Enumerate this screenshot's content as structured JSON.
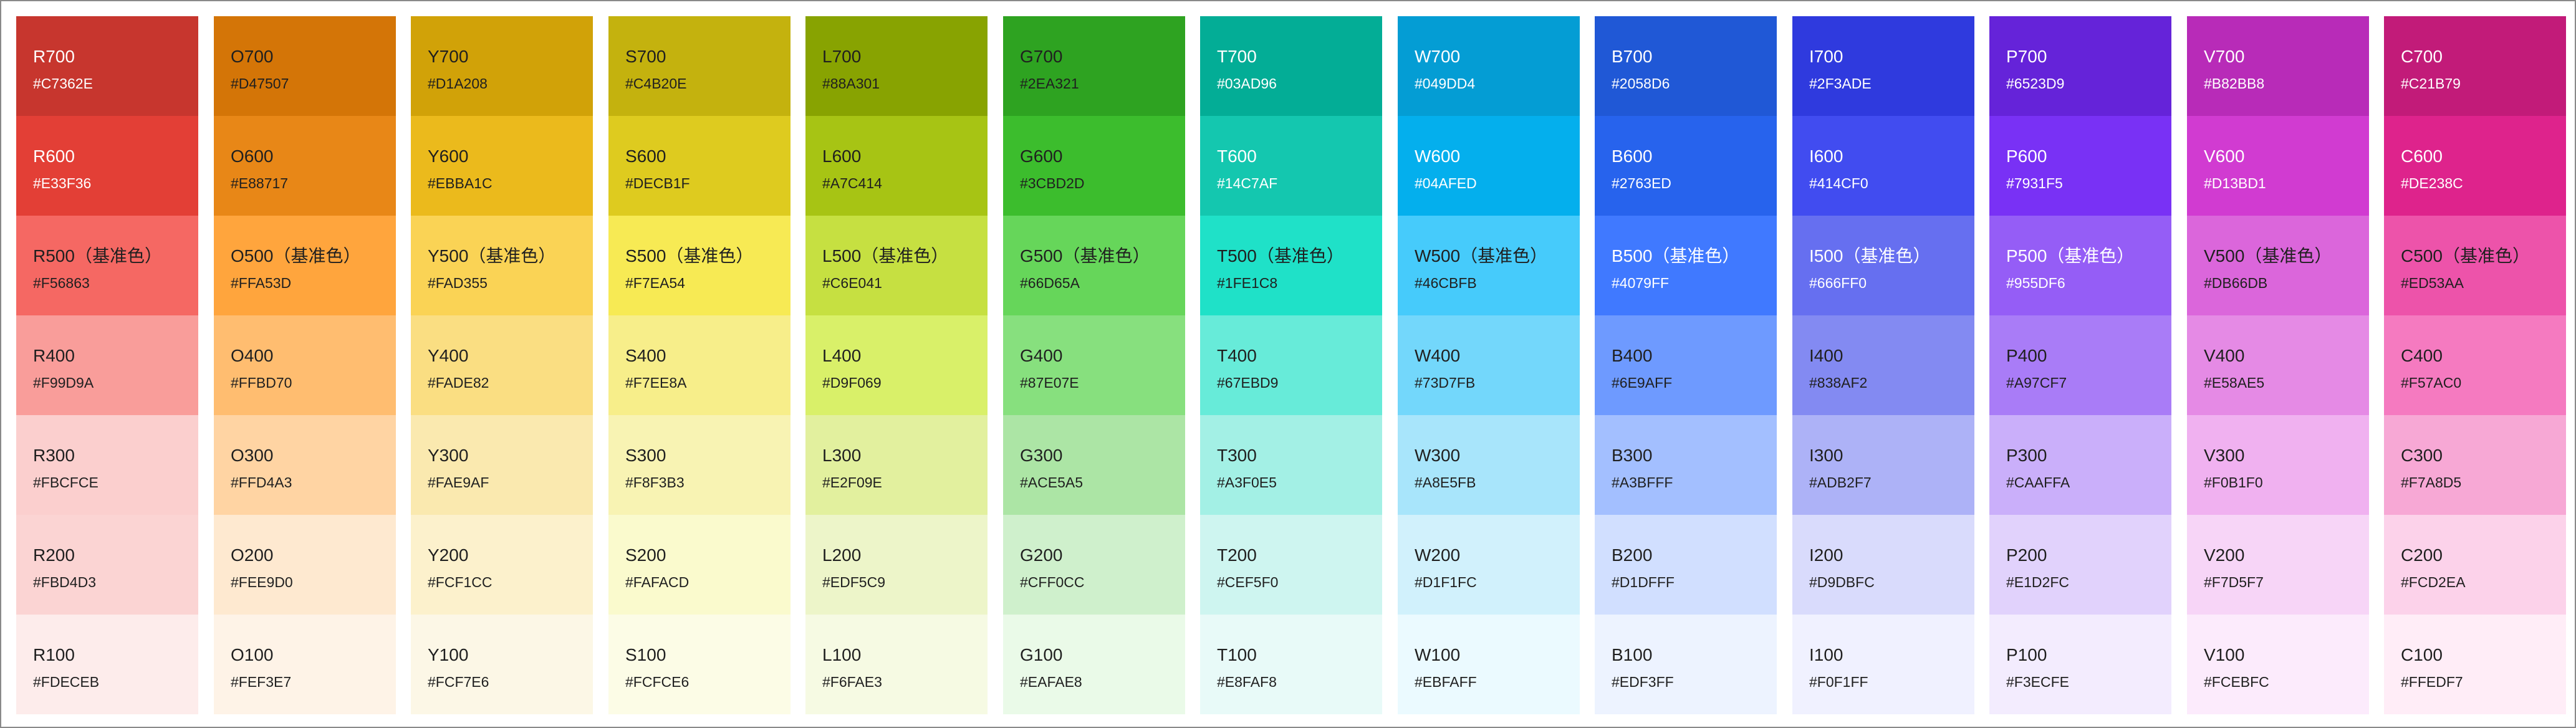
{
  "palette": [
    {
      "family": "red",
      "swatches": [
        {
          "name": "R700",
          "hex": "#C7362E",
          "color": "#C7362E",
          "text": "light"
        },
        {
          "name": "R600",
          "hex": "#E33F36",
          "color": "#E33F36",
          "text": "light"
        },
        {
          "name": "R500（基准色）",
          "hex": "#F56863",
          "color": "#F56863",
          "text": "dark"
        },
        {
          "name": "R400",
          "hex": "#F99D9A",
          "color": "#F99D9A",
          "text": "dark"
        },
        {
          "name": "R300",
          "hex": "#FBCFCE",
          "color": "#FBCFCE",
          "text": "dark"
        },
        {
          "name": "R200",
          "hex": "#FBD4D3",
          "color": "#FBD4D3",
          "text": "dark"
        },
        {
          "name": "R100",
          "hex": "#FDECEB",
          "color": "#FDECEB",
          "text": "dark"
        }
      ]
    },
    {
      "family": "orange",
      "swatches": [
        {
          "name": "O700",
          "hex": "#D47507",
          "color": "#D47507",
          "text": "dark"
        },
        {
          "name": "O600",
          "hex": "#E88717",
          "color": "#E88717",
          "text": "dark"
        },
        {
          "name": "O500（基准色）",
          "hex": "#FFA53D",
          "color": "#FFA53D",
          "text": "dark"
        },
        {
          "name": "O400",
          "hex": "#FFBD70",
          "color": "#FFBD70",
          "text": "dark"
        },
        {
          "name": "O300",
          "hex": "#FFD4A3",
          "color": "#FFD4A3",
          "text": "dark"
        },
        {
          "name": "O200",
          "hex": "#FEE9D0",
          "color": "#FEE9D0",
          "text": "dark"
        },
        {
          "name": "O100",
          "hex": "#FEF3E7",
          "color": "#FEF3E7",
          "text": "dark"
        }
      ]
    },
    {
      "family": "yellow",
      "swatches": [
        {
          "name": "Y700",
          "hex": "#D1A208",
          "color": "#D1A208",
          "text": "dark"
        },
        {
          "name": "Y600",
          "hex": "#EBBA1C",
          "color": "#EBBA1C",
          "text": "dark"
        },
        {
          "name": "Y500（基准色）",
          "hex": "#FAD355",
          "color": "#FAD355",
          "text": "dark"
        },
        {
          "name": "Y400",
          "hex": "#FADE82",
          "color": "#FADE82",
          "text": "dark"
        },
        {
          "name": "Y300",
          "hex": "#FAE9AF",
          "color": "#FAE9AF",
          "text": "dark"
        },
        {
          "name": "Y200",
          "hex": "#FCF1CC",
          "color": "#FCF1CC",
          "text": "dark"
        },
        {
          "name": "Y100",
          "hex": "#FCF7E6",
          "color": "#FCF7E6",
          "text": "dark"
        }
      ]
    },
    {
      "family": "s",
      "swatches": [
        {
          "name": "S700",
          "hex": "#C4B20E",
          "color": "#C4B20E",
          "text": "dark"
        },
        {
          "name": "S600",
          "hex": "#DECB1F",
          "color": "#DECB1F",
          "text": "dark"
        },
        {
          "name": "S500（基准色）",
          "hex": "#F7EA54",
          "color": "#F7EA54",
          "text": "dark"
        },
        {
          "name": "S400",
          "hex": "#F7EE8A",
          "color": "#F7EE8A",
          "text": "dark"
        },
        {
          "name": "S300",
          "hex": "#F8F3B3",
          "color": "#F8F3B3",
          "text": "dark"
        },
        {
          "name": "S200",
          "hex": "#FAFACD",
          "color": "#FAFACD",
          "text": "dark"
        },
        {
          "name": "S100",
          "hex": "#FCFCE6",
          "color": "#FCFCE6",
          "text": "dark"
        }
      ]
    },
    {
      "family": "lime",
      "swatches": [
        {
          "name": "L700",
          "hex": "#88A301",
          "color": "#88A301",
          "text": "dark"
        },
        {
          "name": "L600",
          "hex": "#A7C414",
          "color": "#A7C414",
          "text": "dark"
        },
        {
          "name": "L500（基准色）",
          "hex": "#C6E041",
          "color": "#C6E041",
          "text": "dark"
        },
        {
          "name": "L400",
          "hex": "#D9F069",
          "color": "#D9F069",
          "text": "dark"
        },
        {
          "name": "L300",
          "hex": "#E2F09E",
          "color": "#E2F09E",
          "text": "dark"
        },
        {
          "name": "L200",
          "hex": "#EDF5C9",
          "color": "#EDF5C9",
          "text": "dark"
        },
        {
          "name": "L100",
          "hex": "#F6FAE3",
          "color": "#F6FAE3",
          "text": "dark"
        }
      ]
    },
    {
      "family": "green",
      "swatches": [
        {
          "name": "G700",
          "hex": "#2EA321",
          "color": "#2EA321",
          "text": "dark"
        },
        {
          "name": "G600",
          "hex": "#3CBD2D",
          "color": "#3CBD2D",
          "text": "dark"
        },
        {
          "name": "G500（基准色）",
          "hex": "#66D65A",
          "color": "#66D65A",
          "text": "dark"
        },
        {
          "name": "G400",
          "hex": "#87E07E",
          "color": "#87E07E",
          "text": "dark"
        },
        {
          "name": "G300",
          "hex": "#ACE5A5",
          "color": "#ACE5A5",
          "text": "dark"
        },
        {
          "name": "G200",
          "hex": "#CFF0CC",
          "color": "#CFF0CC",
          "text": "dark"
        },
        {
          "name": "G100",
          "hex": "#EAFAE8",
          "color": "#EAFAE8",
          "text": "dark"
        }
      ]
    },
    {
      "family": "teal",
      "swatches": [
        {
          "name": "T700",
          "hex": "#03AD96",
          "color": "#03AD96",
          "text": "light"
        },
        {
          "name": "T600",
          "hex": "#14C7AF",
          "color": "#14C7AF",
          "text": "light"
        },
        {
          "name": "T500（基准色）",
          "hex": "#1FE1C8",
          "color": "#1FE1C8",
          "text": "dark"
        },
        {
          "name": "T400",
          "hex": "#67EBD9",
          "color": "#67EBD9",
          "text": "dark"
        },
        {
          "name": "T300",
          "hex": "#A3F0E5",
          "color": "#A3F0E5",
          "text": "dark"
        },
        {
          "name": "T200",
          "hex": "#CEF5F0",
          "color": "#CEF5F0",
          "text": "dark"
        },
        {
          "name": "T100",
          "hex": "#E8FAF8",
          "color": "#E8FAF8",
          "text": "dark"
        }
      ]
    },
    {
      "family": "w",
      "swatches": [
        {
          "name": "W700",
          "hex": "#049DD4",
          "color": "#049DD4",
          "text": "light"
        },
        {
          "name": "W600",
          "hex": "#04AFED",
          "color": "#04AFED",
          "text": "light"
        },
        {
          "name": "W500（基准色）",
          "hex": "#46CBFB",
          "color": "#46CBFB",
          "text": "dark"
        },
        {
          "name": "W400",
          "hex": "#73D7FB",
          "color": "#73D7FB",
          "text": "dark"
        },
        {
          "name": "W300",
          "hex": "#A8E5FB",
          "color": "#A8E5FB",
          "text": "dark"
        },
        {
          "name": "W200",
          "hex": "#D1F1FC",
          "color": "#D1F1FC",
          "text": "dark"
        },
        {
          "name": "W100",
          "hex": "#EBFAFF",
          "color": "#EBFAFF",
          "text": "dark"
        }
      ]
    },
    {
      "family": "blue",
      "swatches": [
        {
          "name": "B700",
          "hex": "#2058D6",
          "color": "#2058D6",
          "text": "light"
        },
        {
          "name": "B600",
          "hex": "#2763ED",
          "color": "#2763ED",
          "text": "light"
        },
        {
          "name": "B500（基准色）",
          "hex": "#4079FF",
          "color": "#4079FF",
          "text": "light"
        },
        {
          "name": "B400",
          "hex": "#6E9AFF",
          "color": "#6E9AFF",
          "text": "dark"
        },
        {
          "name": "B300",
          "hex": "#A3BFFF",
          "color": "#A3BFFF",
          "text": "dark"
        },
        {
          "name": "B200",
          "hex": "#D1DFFF",
          "color": "#D1DFFF",
          "text": "dark"
        },
        {
          "name": "B100",
          "hex": "#EDF3FF",
          "color": "#EDF3FF",
          "text": "dark"
        }
      ]
    },
    {
      "family": "indigo",
      "swatches": [
        {
          "name": "I700",
          "hex": "#2F3ADE",
          "color": "#2F3ADE",
          "text": "light"
        },
        {
          "name": "I600",
          "hex": "#414CF0",
          "color": "#414CF0",
          "text": "light"
        },
        {
          "name": "I500（基准色）",
          "hex": "#666FF0",
          "color": "#666FF0",
          "text": "light"
        },
        {
          "name": "I400",
          "hex": "#838AF2",
          "color": "#838AF2",
          "text": "dark"
        },
        {
          "name": "I300",
          "hex": "#ADB2F7",
          "color": "#ADB2F7",
          "text": "dark"
        },
        {
          "name": "I200",
          "hex": "#D9DBFC",
          "color": "#D9DBFC",
          "text": "dark"
        },
        {
          "name": "I100",
          "hex": "#F0F1FF",
          "color": "#F0F1FF",
          "text": "dark"
        }
      ]
    },
    {
      "family": "purple",
      "swatches": [
        {
          "name": "P700",
          "hex": "#6523D9",
          "color": "#6523D9",
          "text": "light"
        },
        {
          "name": "P600",
          "hex": "#7931F5",
          "color": "#7931F5",
          "text": "light"
        },
        {
          "name": "P500（基准色）",
          "hex": "#955DF6",
          "color": "#955DF6",
          "text": "light"
        },
        {
          "name": "P400",
          "hex": "#A97CF7",
          "color": "#A97CF7",
          "text": "dark"
        },
        {
          "name": "P300",
          "hex": "#CAAFFA",
          "color": "#CAAFFA",
          "text": "dark"
        },
        {
          "name": "P200",
          "hex": "#E1D2FC",
          "color": "#E1D2FC",
          "text": "dark"
        },
        {
          "name": "P100",
          "hex": "#F3ECFE",
          "color": "#F3ECFE",
          "text": "dark"
        }
      ]
    },
    {
      "family": "violet",
      "swatches": [
        {
          "name": "V700",
          "hex": "#B82BB8",
          "color": "#B82BB8",
          "text": "light"
        },
        {
          "name": "V600",
          "hex": "#D13BD1",
          "color": "#D13BD1",
          "text": "light"
        },
        {
          "name": "V500（基准色）",
          "hex": "#DB66DB",
          "color": "#DB66DB",
          "text": "dark"
        },
        {
          "name": "V400",
          "hex": "#E58AE5",
          "color": "#E58AE5",
          "text": "dark"
        },
        {
          "name": "V300",
          "hex": "#F0B1F0",
          "color": "#F0B1F0",
          "text": "dark"
        },
        {
          "name": "V200",
          "hex": "#F7D5F7",
          "color": "#F7D5F7",
          "text": "dark"
        },
        {
          "name": "V100",
          "hex": "#FCEBFC",
          "color": "#FCEBFC",
          "text": "dark"
        }
      ]
    },
    {
      "family": "c",
      "swatches": [
        {
          "name": "C700",
          "hex": "#C21B79",
          "color": "#C21B79",
          "text": "light"
        },
        {
          "name": "C600",
          "hex": "#DE238C",
          "color": "#DE238C",
          "text": "light"
        },
        {
          "name": "C500（基准色）",
          "hex": "#ED53AA",
          "color": "#ED53AA",
          "text": "dark"
        },
        {
          "name": "C400",
          "hex": "#F57AC0",
          "color": "#F57AC0",
          "text": "dark"
        },
        {
          "name": "C300",
          "hex": "#F7A8D5",
          "color": "#F7A8D5",
          "text": "dark"
        },
        {
          "name": "C200",
          "hex": "#FCD2EA",
          "color": "#FCD2EA",
          "text": "dark"
        },
        {
          "name": "C100",
          "hex": "#FFEDF7",
          "color": "#FFEDF7",
          "text": "dark"
        }
      ]
    }
  ]
}
